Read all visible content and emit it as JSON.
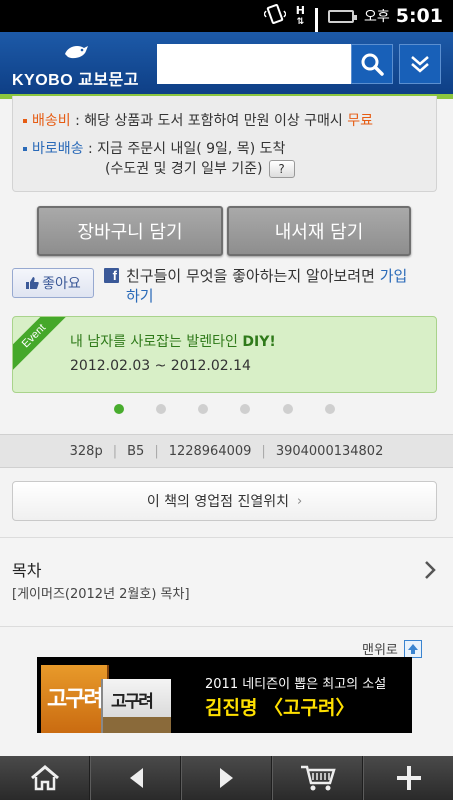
{
  "status_bar": {
    "ampm": "오후",
    "time": "5:01",
    "network_label": "H",
    "icons": [
      "vibrate-icon",
      "h-network-icon",
      "signal-icon",
      "battery-icon"
    ]
  },
  "header": {
    "logo_text": "KYOBO 교보문고",
    "search": {
      "value": "",
      "placeholder": ""
    },
    "search_icon": "search-icon",
    "menu_icon": "chevron-double-down-icon",
    "accent_color": "#8cc63f"
  },
  "info": {
    "shipping": {
      "label": "배송비",
      "text": " : 해당 상품과 도서 포함하여 만원 이상 구매시 ",
      "free": "무료"
    },
    "direct": {
      "label": "바로배송",
      "text": " : 지금 주문시 내일( 9일, 목) 도착",
      "sub": "(수도권 및 경기 일부 기준)",
      "help": "?"
    }
  },
  "actions": {
    "cart": "장바구니 담기",
    "shelf": "내서재 담기"
  },
  "facebook": {
    "like": "좋아요",
    "text_before": "친구들이 무엇을 좋아하는지 알아보려면 ",
    "join": "가입하기"
  },
  "event": {
    "ribbon": "Event",
    "title": "내 남자를 사로잡는 발렌타인 ",
    "title_bold": "DIY!",
    "dates": "2012.02.03 ~ 2012.02.14"
  },
  "pager": {
    "count": 6,
    "active_index": 0
  },
  "specs": [
    "328p",
    "B5",
    "1228964009",
    "3904000134802"
  ],
  "store_location": {
    "label": "이 책의 영업점 진열위치",
    "chevron": "›"
  },
  "toc": {
    "title": "목차",
    "desc": "[게이머즈(2012년 2월호) 목차]"
  },
  "back_to_top": {
    "label": "맨위로"
  },
  "ad": {
    "book_title": "고구려",
    "line1": "2011 네티즌이 뽑은 최고의 소설",
    "line2": "김진명 〈고구려〉"
  },
  "bottom_nav": [
    {
      "icon": "home-icon"
    },
    {
      "icon": "back-icon"
    },
    {
      "icon": "forward-icon"
    },
    {
      "icon": "cart-icon"
    },
    {
      "icon": "plus-icon"
    }
  ]
}
